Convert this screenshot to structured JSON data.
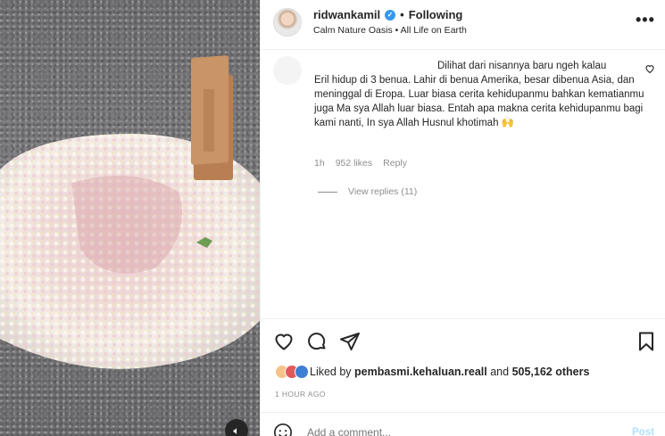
{
  "post": {
    "username": "ridwankamil",
    "separator": "•",
    "follow_status": "Following",
    "audio": "Calm Nature Oasis",
    "audio_separator": "•",
    "audio_detail": "All Life on Earth",
    "more_label": "•••"
  },
  "comment": {
    "line1": "Dilihat dari nisannya baru ngeh kalau",
    "rest": "Eril hidup di 3 benua. Lahir di benua Amerika, besar dibenua Asia, dan meninggal di Eropa. Luar biasa cerita kehidupanmu bahkan kematianmu juga Ma sya Allah luar biasa. Entah apa makna cerita kehidupanmu bagi kami nanti, In sya Allah Husnul khotimah 🙌",
    "time": "1h",
    "likes": "952 likes",
    "reply_label": "Reply",
    "view_replies": "View replies (11)"
  },
  "actions": {
    "like_icon": "heart-icon",
    "comment_icon": "comment-icon",
    "share_icon": "send-icon",
    "save_icon": "bookmark-icon"
  },
  "likes": {
    "prefix": "Liked by",
    "user": "pembasmi.kehaluan.reall",
    "and": "and",
    "others": "505,162 others"
  },
  "timestamp": "1 HOUR AGO",
  "add_comment": {
    "placeholder": "Add a comment...",
    "post_label": "Post"
  },
  "colors": {
    "verified": "#3897f0",
    "muted": "#8e8e8e",
    "post_disabled": "#b2dffc"
  }
}
